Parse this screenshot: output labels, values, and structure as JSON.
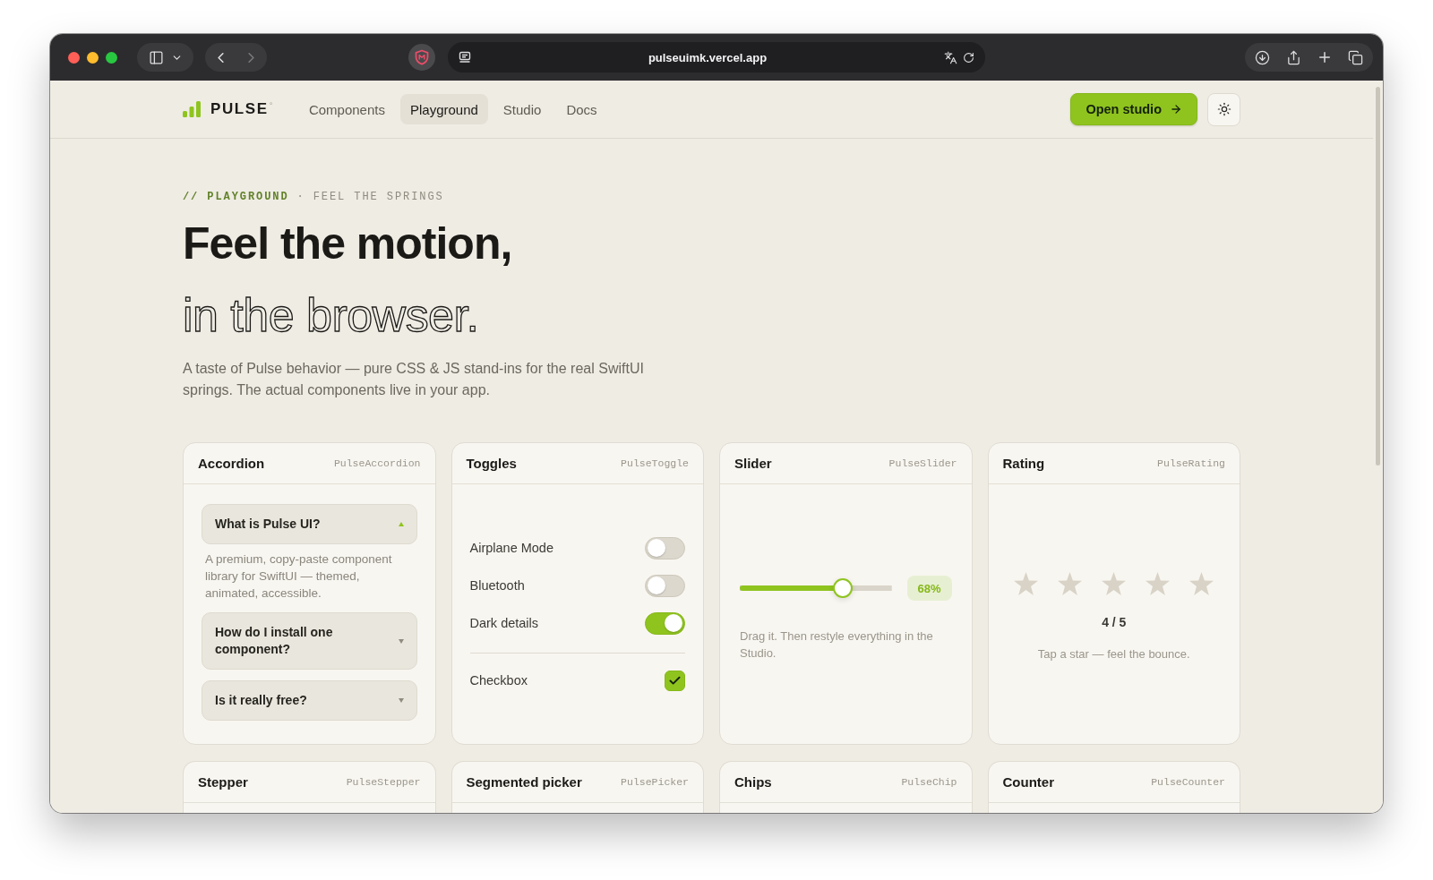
{
  "browser": {
    "url": "pulseuimk.vercel.app"
  },
  "nav": {
    "brand": "PULSE$^{°}$",
    "links": [
      {
        "label": "Components",
        "selected": false
      },
      {
        "label": "Playground",
        "selected": true
      },
      {
        "label": "Studio",
        "selected": false
      },
      {
        "label": "Docs",
        "selected": false
      }
    ],
    "cta": "Open studio"
  },
  "hero": {
    "eyebrow": {
      "section": "// PLAYGROUND",
      "separator": "·",
      "subtitle": "FEEL THE SPRINGS"
    },
    "title": "Feel the motion,",
    "title_outline": "in the browser.",
    "intro": "A taste of Pulse behavior — pure CSS & JS stand-ins for the real SwiftUI springs. The actual components live in your app."
  },
  "cards": [
    {
      "kind": "accordion",
      "title": "Accordion",
      "tag": "PulseAccordion",
      "items": [
        {
          "question": "What is Pulse UI?",
          "expanded": true,
          "answer": "A premium, copy-paste component library for SwiftUI — themed, animated, accessible."
        },
        {
          "question": "How do I install one component?",
          "expanded": false
        },
        {
          "question": "Is it really free?",
          "expanded": false
        }
      ]
    },
    {
      "kind": "toggles",
      "title": "Toggles",
      "tag": "PulseToggle",
      "rows": [
        {
          "kind": "switch",
          "label": "Airplane Mode",
          "on": false
        },
        {
          "kind": "switch",
          "label": "Bluetooth",
          "on": false
        },
        {
          "kind": "switch",
          "label": "Dark details",
          "on": true
        },
        {
          "kind": "checkbox",
          "label": "Checkbox",
          "checked": true
        }
      ]
    },
    {
      "kind": "slider",
      "title": "Slider",
      "tag": "PulseSlider",
      "level": 0.68,
      "reading": "68%",
      "hint": "Drag it. Then restyle everything in the Studio."
    },
    {
      "kind": "rating",
      "title": "Rating",
      "tag": "PulseRating",
      "stars": 0,
      "score": "4 / 5",
      "hint": "Tap a star — feel the bounce."
    },
    {
      "kind": "stepper",
      "title": "Stepper",
      "tag": "PulseStepper"
    },
    {
      "kind": "picker",
      "title": "Segmented picker",
      "tag": "PulsePicker"
    },
    {
      "kind": "chips",
      "title": "Chips",
      "tag": "PulseChip"
    },
    {
      "kind": "counter",
      "title": "Counter",
      "tag": "PulseCounter"
    }
  ]
}
